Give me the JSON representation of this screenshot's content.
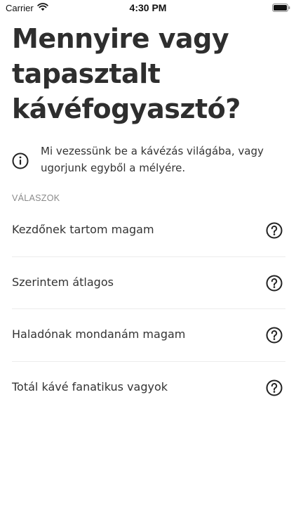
{
  "status_bar": {
    "carrier": "Carrier",
    "time": "4:30 PM",
    "icons": [
      "wifi-icon",
      "battery-icon"
    ]
  },
  "title": "Mennyire vagy tapasztalt kávéfogyasztó?",
  "info": {
    "icon": "info-icon",
    "text": "Mi vezessünk be a kávézás világába, vagy ugorjunk egyből a mélyére."
  },
  "answers": {
    "section_label": "VÁLASZOK",
    "items": [
      {
        "label": "Kezdőnek tartom magam",
        "icon": "help-icon"
      },
      {
        "label": "Szerintem átlagos",
        "icon": "help-icon"
      },
      {
        "label": "Haladónak mondanám magam",
        "icon": "help-icon"
      },
      {
        "label": "Totál kávé fanatikus vagyok",
        "icon": "help-icon"
      }
    ]
  },
  "colors": {
    "background": "#ffffff",
    "title": "#2e2e2e",
    "text": "#333333",
    "muted": "#8a8a8a",
    "divider": "#ececec"
  }
}
